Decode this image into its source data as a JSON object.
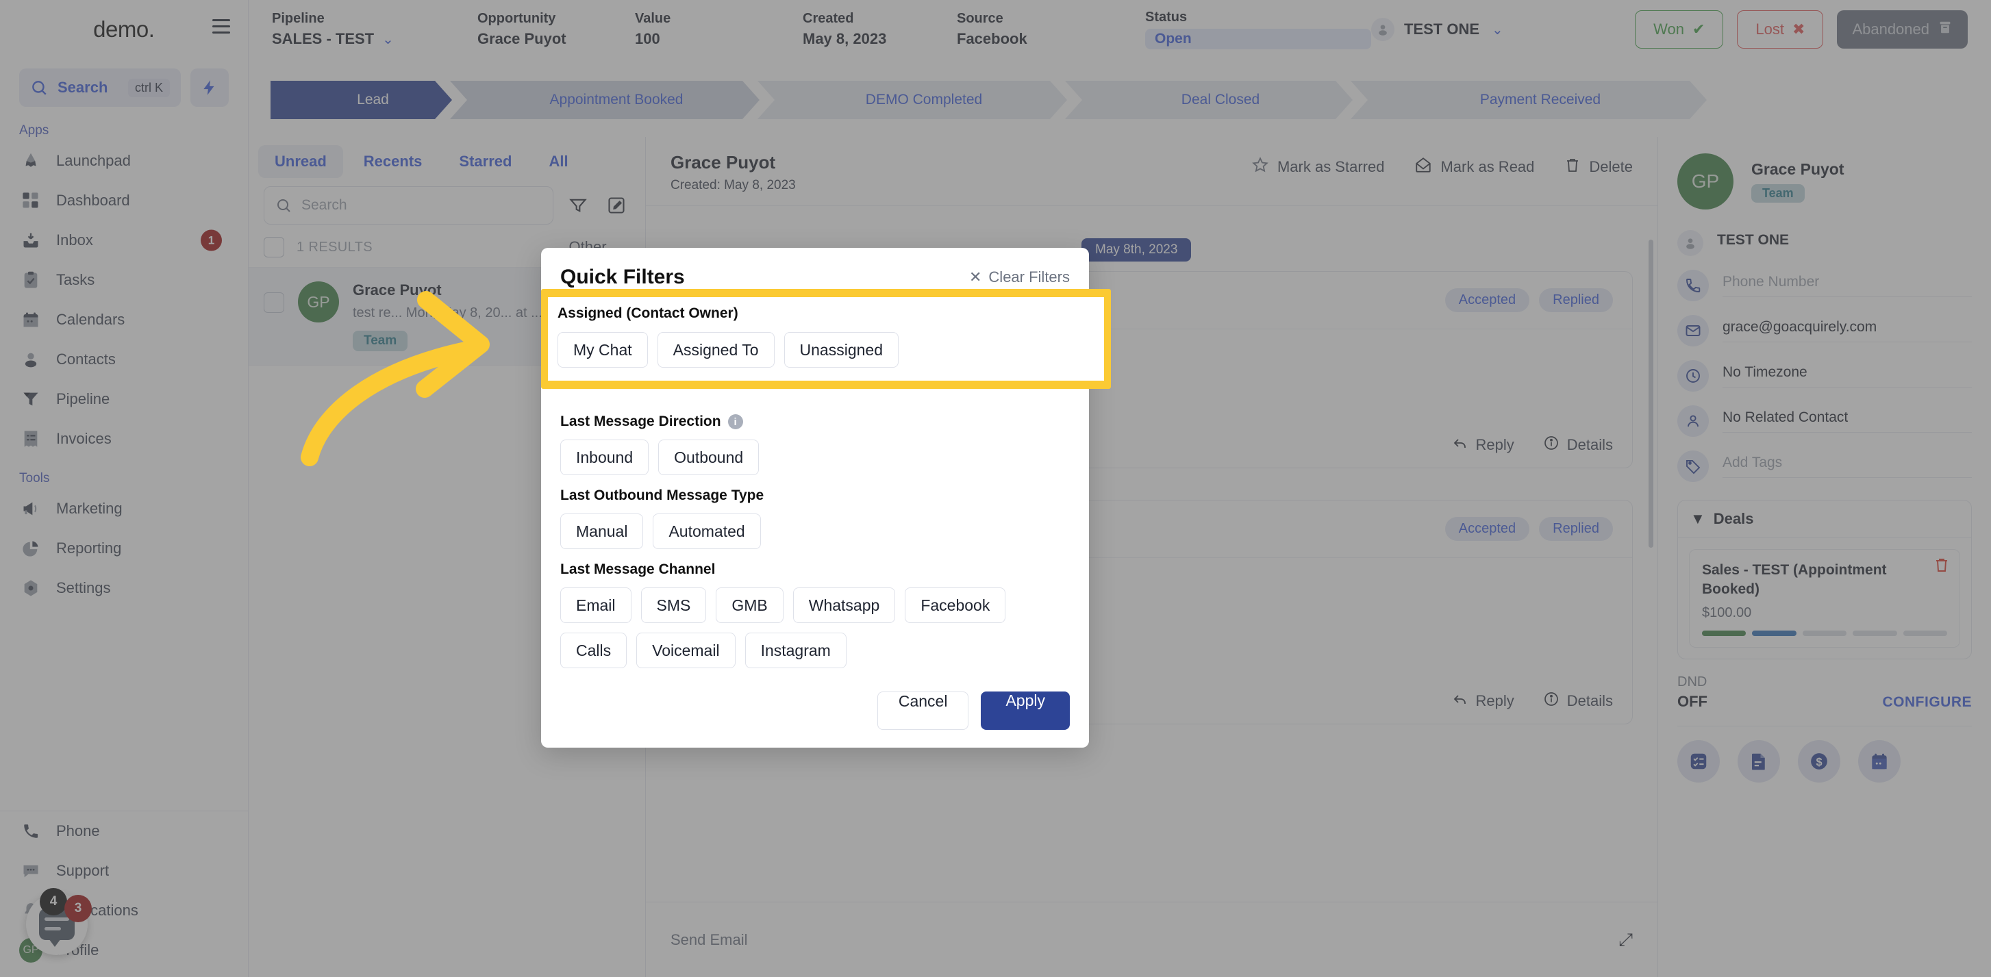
{
  "sidebar": {
    "brand": "demo",
    "brand_dot": ".",
    "search": {
      "label": "Search",
      "shortcut": "ctrl K"
    },
    "apps_label": "Apps",
    "tools_label": "Tools",
    "apps": [
      {
        "label": "Launchpad",
        "icon": "launchpad-icon"
      },
      {
        "label": "Dashboard",
        "icon": "dashboard-icon"
      },
      {
        "label": "Inbox",
        "icon": "inbox-icon",
        "badge": "1"
      },
      {
        "label": "Tasks",
        "icon": "tasks-icon"
      },
      {
        "label": "Calendars",
        "icon": "calendar-icon"
      },
      {
        "label": "Contacts",
        "icon": "contacts-icon"
      },
      {
        "label": "Pipeline",
        "icon": "pipeline-icon"
      },
      {
        "label": "Invoices",
        "icon": "invoices-icon"
      }
    ],
    "tools": [
      {
        "label": "Marketing",
        "icon": "megaphone-icon"
      },
      {
        "label": "Reporting",
        "icon": "pie-chart-icon"
      },
      {
        "label": "Settings",
        "icon": "gear-icon"
      }
    ],
    "bottom": [
      {
        "label": "Phone",
        "icon": "phone-icon"
      },
      {
        "label": "Support",
        "icon": "support-chat-icon"
      },
      {
        "label": "Notifications",
        "icon": "bell-icon"
      },
      {
        "label": "Profile",
        "icon": "avatar-icon",
        "initials": "GP"
      }
    ],
    "chat_widget": {
      "badge_dark": "4",
      "badge_red": "3"
    }
  },
  "header": {
    "fields": [
      {
        "label": "Pipeline",
        "value": "SALES - TEST",
        "has_chevron": true
      },
      {
        "label": "Opportunity",
        "value": "Grace Puyot"
      },
      {
        "label": "Value",
        "value": "100"
      },
      {
        "label": "Created",
        "value": "May 8, 2023"
      },
      {
        "label": "Source",
        "value": "Facebook"
      },
      {
        "label": "Status",
        "value": "Open"
      }
    ],
    "owner": "TEST ONE",
    "won_label": "Won",
    "lost_label": "Lost",
    "abandoned_label": "Abandoned"
  },
  "stages": [
    {
      "label": "Lead",
      "active": true
    },
    {
      "label": "Appointment Booked",
      "active": false
    },
    {
      "label": "DEMO Completed",
      "active": false
    },
    {
      "label": "Deal Closed",
      "active": false
    },
    {
      "label": "Payment Received",
      "active": false
    }
  ],
  "conversations": {
    "tabs": [
      {
        "label": "Unread",
        "active": true
      },
      {
        "label": "Recents",
        "active": false
      },
      {
        "label": "Starred",
        "active": false
      },
      {
        "label": "All",
        "active": false
      }
    ],
    "search_placeholder": "Search",
    "results_count": "1 RESULTS",
    "sort_label": "Other",
    "items": [
      {
        "initials": "GP",
        "name": "Grace Puyot",
        "snippet": "test re... Mon, May 8, 20... at ...",
        "tag": "Team"
      }
    ]
  },
  "message_pane": {
    "title": "Grace Puyot",
    "subtitle": "Created: May 8, 2023",
    "actions": [
      {
        "label": "Mark as Starred",
        "icon": "star-icon"
      },
      {
        "label": "Mark as Read",
        "icon": "envelope-open-icon"
      },
      {
        "label": "Delete",
        "icon": "trash-icon"
      }
    ],
    "date_divider": "May 8th, 2023",
    "cards": [
      {
        "pills": [
          "Accepted",
          "Replied"
        ],
        "footer": [
          {
            "label": "Reply",
            "icon": "reply-icon"
          },
          {
            "label": "Details",
            "icon": "info-icon"
          }
        ]
      },
      {
        "pills": [
          "Accepted",
          "Replied"
        ],
        "footer": [
          {
            "label": "Reply",
            "icon": "reply-icon"
          },
          {
            "label": "Details",
            "icon": "info-icon"
          }
        ]
      }
    ],
    "composer_placeholder": "Send Email"
  },
  "contact_panel": {
    "initials": "GP",
    "name": "Grace Puyot",
    "tag": "Team",
    "owner": "TEST ONE",
    "phone_placeholder": "Phone Number",
    "email": "grace@goacquirely.com",
    "timezone": "No Timezone",
    "related_contact": "No Related Contact",
    "tags_placeholder": "Add Tags",
    "deals_label": "Deals",
    "deal": {
      "title": "Sales - TEST (Appointment Booked)",
      "amount": "$100.00",
      "progress_colors": [
        "#3f7f45",
        "#2f6fb5",
        "#d8dbe3",
        "#d8dbe3",
        "#d8dbe3"
      ]
    },
    "dnd_label": "DND",
    "dnd_value": "OFF",
    "configure_label": "CONFIGURE",
    "quick_actions": [
      {
        "icon": "tasks-list-icon"
      },
      {
        "icon": "document-icon"
      },
      {
        "icon": "dollar-icon"
      },
      {
        "icon": "calendar-small-icon"
      }
    ]
  },
  "quick_filters": {
    "title": "Quick Filters",
    "clear_label": "Clear Filters",
    "groups": [
      {
        "label": "Assigned (Contact Owner)",
        "has_info": false,
        "highlighted": true,
        "options": [
          "My Chat",
          "Assigned To",
          "Unassigned"
        ]
      },
      {
        "label": "Last Message Direction",
        "has_info": true,
        "highlighted": false,
        "options": [
          "Inbound",
          "Outbound"
        ]
      },
      {
        "label": "Last Outbound Message Type",
        "has_info": false,
        "highlighted": false,
        "options": [
          "Manual",
          "Automated"
        ]
      },
      {
        "label": "Last Message Channel",
        "has_info": false,
        "highlighted": false,
        "options": [
          "Email",
          "SMS",
          "GMB",
          "Whatsapp",
          "Facebook",
          "Calls",
          "Voicemail",
          "Instagram"
        ]
      }
    ],
    "cancel_label": "Cancel",
    "apply_label": "Apply"
  },
  "colors": {
    "accent_blue": "#3b5bdb",
    "deep_blue": "#2d4496",
    "highlight_yellow": "#fbca33",
    "green": "#43a047",
    "red": "#e05252",
    "avatar_green": "#3f7f45"
  }
}
